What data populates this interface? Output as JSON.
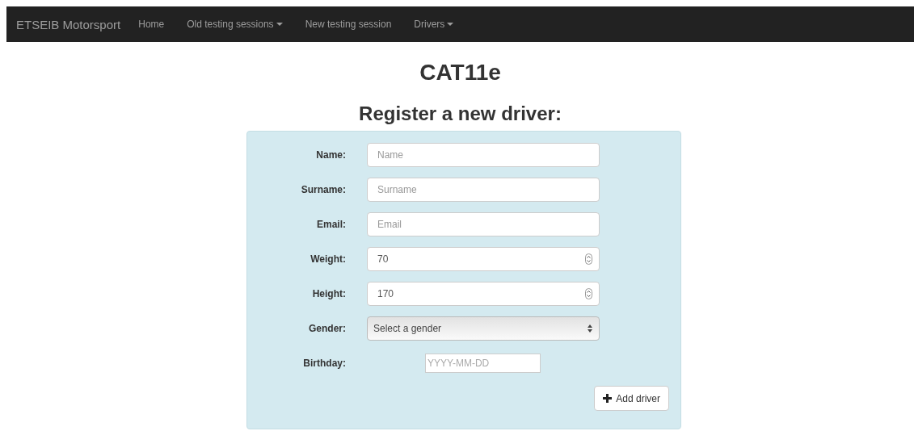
{
  "navbar": {
    "brand": "ETSEIB Motorsport",
    "items": [
      {
        "label": "Home",
        "dropdown": false
      },
      {
        "label": "Old testing sessions",
        "dropdown": true
      },
      {
        "label": "New testing session",
        "dropdown": false
      },
      {
        "label": "Drivers",
        "dropdown": true
      }
    ]
  },
  "title": "CAT11e",
  "form": {
    "heading": "Register a new driver:",
    "fields": [
      {
        "label": "Name:",
        "kind": "text",
        "placeholder": "Name"
      },
      {
        "label": "Surname:",
        "kind": "text",
        "placeholder": "Surname"
      },
      {
        "label": "Email:",
        "kind": "text",
        "placeholder": "Email"
      },
      {
        "label": "Weight:",
        "kind": "number",
        "value": "70"
      },
      {
        "label": "Height:",
        "kind": "number",
        "value": "170"
      },
      {
        "label": "Gender:",
        "kind": "select",
        "value": "Select a gender"
      },
      {
        "label": "Birthday:",
        "kind": "date",
        "placeholder": "YYYY-MM-DD"
      }
    ],
    "submit": "Add driver"
  }
}
